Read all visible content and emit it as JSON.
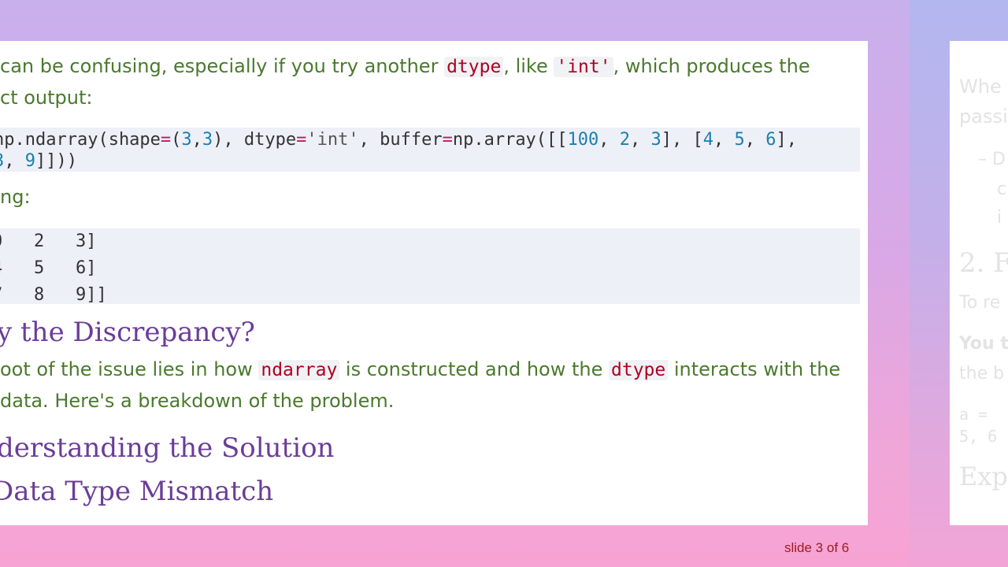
{
  "para1": {
    "line1_a": "can be confusing, especially if you try another ",
    "line1_kw1": "dtype",
    "line1_b": ", like ",
    "line1_kw2": "'int'",
    "line1_c": ", which produces the",
    "line2": "ct output:"
  },
  "code1": {
    "l1_a": "np.ndarray(shape",
    "l1_op1": "=",
    "l1_b": "(",
    "l1_n1": "3",
    "l1_c": ",",
    "l1_n2": "3",
    "l1_d": "), dtype",
    "l1_op2": "=",
    "l1_str": "'int'",
    "l1_e": ", buffer",
    "l1_op3": "=",
    "l1_f": "np.array([[",
    "l1_n3": "100",
    "l1_g": ", ",
    "l1_n4": "2",
    "l1_h": ", ",
    "l1_n5": "3",
    "l1_i": "], [",
    "l1_n6": "4",
    "l1_j": ", ",
    "l1_n7": "5",
    "l1_k": ", ",
    "l1_n8": "6",
    "l1_l": "],",
    "l2_n1": "3",
    "l2_a": ", ",
    "l2_n2": "9",
    "l2_b": "]]))"
  },
  "label_output": "ng:",
  "output": {
    "rows": [
      "0   2   3]",
      "4   5   6]",
      "7   8   9]]"
    ]
  },
  "heading1": "y the Discrepancy?",
  "para2": {
    "line1_a": "oot of the issue lies in how ",
    "line1_kw1": "ndarray",
    "line1_b": " is constructed and how the ",
    "line1_kw2": "dtype",
    "line1_c": " interacts with the",
    "line2": " data. Here's a breakdown of the problem."
  },
  "heading2": "derstanding the Solution",
  "heading3": "Data Type Mismatch",
  "footer": "slide 3 of 6",
  "ghost_slide": {
    "lines": [
      "Whe",
      "passi",
      "– D",
      "c",
      "i",
      "2. F",
      "To re",
      "You t",
      "the b",
      "a = ",
      "5, 6",
      "Exp"
    ]
  }
}
